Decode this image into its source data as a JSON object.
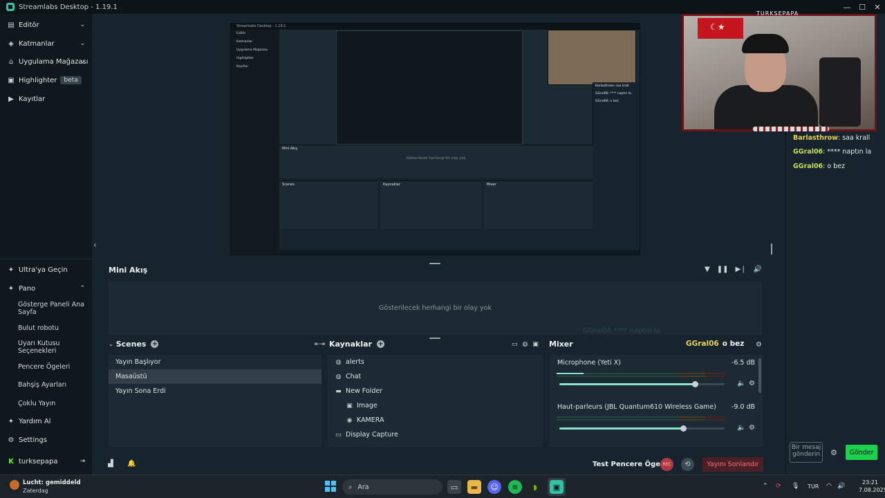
{
  "window": {
    "title": "Streamlabs Desktop - 1.19.1"
  },
  "sidebar": {
    "top": [
      {
        "label": "Editör",
        "icon": "editor-icon"
      },
      {
        "label": "Katmanlar",
        "icon": "layers-icon"
      },
      {
        "label": "Uygulama Mağazası",
        "icon": "store-icon"
      },
      {
        "label": "Highlighter",
        "icon": "highlighter-icon",
        "badge": "beta"
      },
      {
        "label": "Kayıtlar",
        "icon": "play-icon"
      }
    ],
    "bottom": {
      "ultra": "Ultra'ya Geçin",
      "pano": "Pano",
      "pano_items": [
        "Gösterge Paneli Ana Sayfa",
        "Bulut robotu",
        "Uyarı Kutusu Seçenekleri",
        "Pencere Ögeleri",
        "Bahşiş Ayarları",
        "Çoklu Yayın"
      ],
      "help": "Yardım Al",
      "settings": "Settings",
      "user": "turksepapa"
    }
  },
  "nested": {
    "title": "Streamlabs Desktop - 1.19.1",
    "side": [
      "Editör",
      "Katmanlar",
      "Uygulama Mağazası",
      "Highlighter",
      "Kayıtlar"
    ],
    "mini_title": "Mini Akış",
    "empty": "Gösterilecek herhangi bir olay yok",
    "scenes": "Scenes",
    "sources": "Kaynaklar",
    "mixer": "Mixer",
    "chat": [
      "Barlasthrow: saa krall",
      "GGral06: **** naptın la",
      "GGral06: o bez"
    ]
  },
  "mini_feed": {
    "title": "Mini Akış",
    "empty_text": "Gösterilecek herhangi bir olay yok",
    "ghost": "GGral06 **** naptın la"
  },
  "scenes": {
    "title": "Scenes",
    "items": [
      "Yayın Başlıyor",
      "Masaüstü",
      "Yayın Sona Erdi"
    ],
    "selected": 1
  },
  "sources": {
    "title": "Kaynaklar",
    "items": [
      {
        "label": "alerts",
        "icon": "globe-icon",
        "indent": false
      },
      {
        "label": "Chat",
        "icon": "globe-icon",
        "indent": false
      },
      {
        "label": "New Folder",
        "icon": "folder-icon",
        "indent": false
      },
      {
        "label": "Image",
        "icon": "image-icon",
        "indent": true
      },
      {
        "label": "KAMERA",
        "icon": "camera-icon",
        "indent": true
      },
      {
        "label": "Display Capture",
        "icon": "monitor-icon",
        "indent": false
      }
    ]
  },
  "mixer": {
    "title": "Mixer",
    "alert_user": "GGral06",
    "alert_text": "o bez",
    "channels": [
      {
        "name": "Microphone (Yeti X)",
        "db": "-6.5 dB",
        "level": 0.16,
        "volume": 0.82
      },
      {
        "name": "Haut-parleurs (JBL Quantum610 Wireless Game)",
        "db": "-9.0 dB",
        "level": 0.0,
        "volume": 0.75
      }
    ]
  },
  "footer": {
    "test": "Test Pencere Ögeleri",
    "rec": "REC",
    "end": "Yayını Sonlandır"
  },
  "chat": {
    "messages": [
      {
        "user": "Barlasthrow",
        "text": "saa krall"
      },
      {
        "user": "GGral06",
        "text": "**** naptın la"
      },
      {
        "user": "GGral06",
        "text": "o bez"
      }
    ],
    "placeholder": "Bir mesaj gönderin",
    "send": "Gönder"
  },
  "webcam": {
    "label": "TURKSEPAPA"
  },
  "taskbar": {
    "weather_title": "Lucht: gemiddeld",
    "weather_sub": "Zaterdag",
    "search": "Ara",
    "lang": "TUR",
    "time": "23:21",
    "date": "7.08.2025"
  },
  "colors": {
    "accent": "#31c3a2",
    "send": "#1bd24d",
    "end_stream": "#ff6f7b",
    "meter": "#8be4cc"
  }
}
